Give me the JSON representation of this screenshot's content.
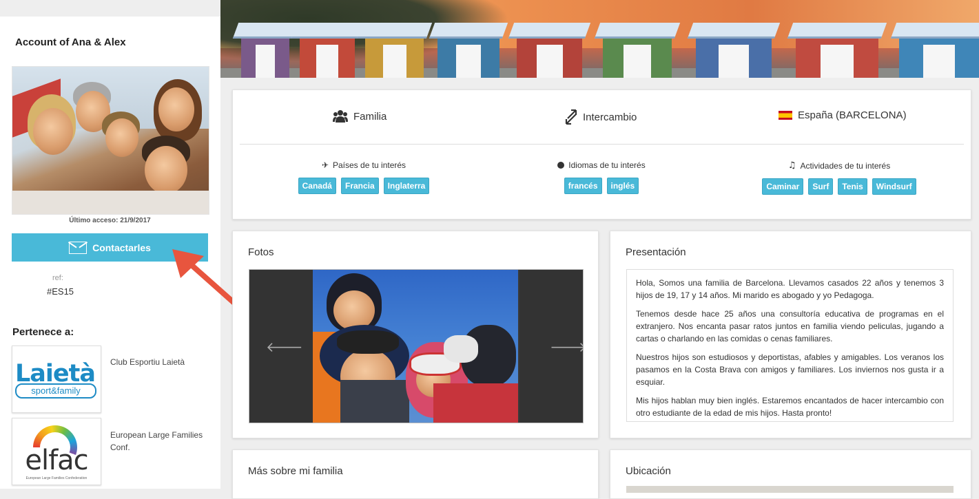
{
  "sidebar": {
    "account_title": "Account of Ana & Alex",
    "last_access": "Último acceso: 21/9/2017",
    "contact_label": "Contactarles",
    "ref_label": "ref:",
    "ref_value": "#ES15",
    "belongs_label": "Pertenece a:",
    "orgs": [
      {
        "name": "Club Esportiu Laietà",
        "logo_text": "Laietà",
        "logo_sub": "sport&family"
      },
      {
        "name": "European Large Families Conf.",
        "logo_text": "elfac",
        "logo_sub": "European Large Families Confederation"
      }
    ]
  },
  "info": {
    "type_label": "Familia",
    "program_label": "Intercambio",
    "location_label": "España (BARCELONA)",
    "countries_head": "Países de tu interés",
    "countries": [
      "Canadá",
      "Francia",
      "Inglaterra"
    ],
    "languages_head": "Idiomas de tu interés",
    "languages": [
      "francés",
      "inglés"
    ],
    "activities_head": "Actividades de tu interés",
    "activities": [
      "Caminar",
      "Surf",
      "Tenis",
      "Windsurf"
    ]
  },
  "photos": {
    "title": "Fotos",
    "prev": "🡐",
    "next": "🡒"
  },
  "presentation": {
    "title": "Presentación",
    "paragraphs": [
      "Hola, Somos una familia de Barcelona. Llevamos casados 22 años y tenemos 3 hijos de 19, 17 y 14 años. Mi marido es abogado y yo Pedagoga.",
      "Tenemos desde hace 25 años una consultoría educativa de programas en el extranjero. Nos encanta pasar ratos juntos en familia viendo peliculas, jugando a cartas o charlando en las comidas o cenas familiares.",
      "Nuestros hijos son estudiosos y deportistas, afables y amigables. Los veranos los pasamos en la Costa Brava con amigos y familiares. Los inviernos nos gusta ir a esquiar.",
      "Mis hijos hablan muy bien inglés. Estaremos encantados de hacer intercambio con otro estudiante de la edad de mis hijos. Hasta pronto!"
    ]
  },
  "more": {
    "title": "Más sobre mi familia"
  },
  "location": {
    "title": "Ubicación"
  },
  "colors": {
    "accent": "#49b9d8",
    "arrow": "#e8553e"
  }
}
